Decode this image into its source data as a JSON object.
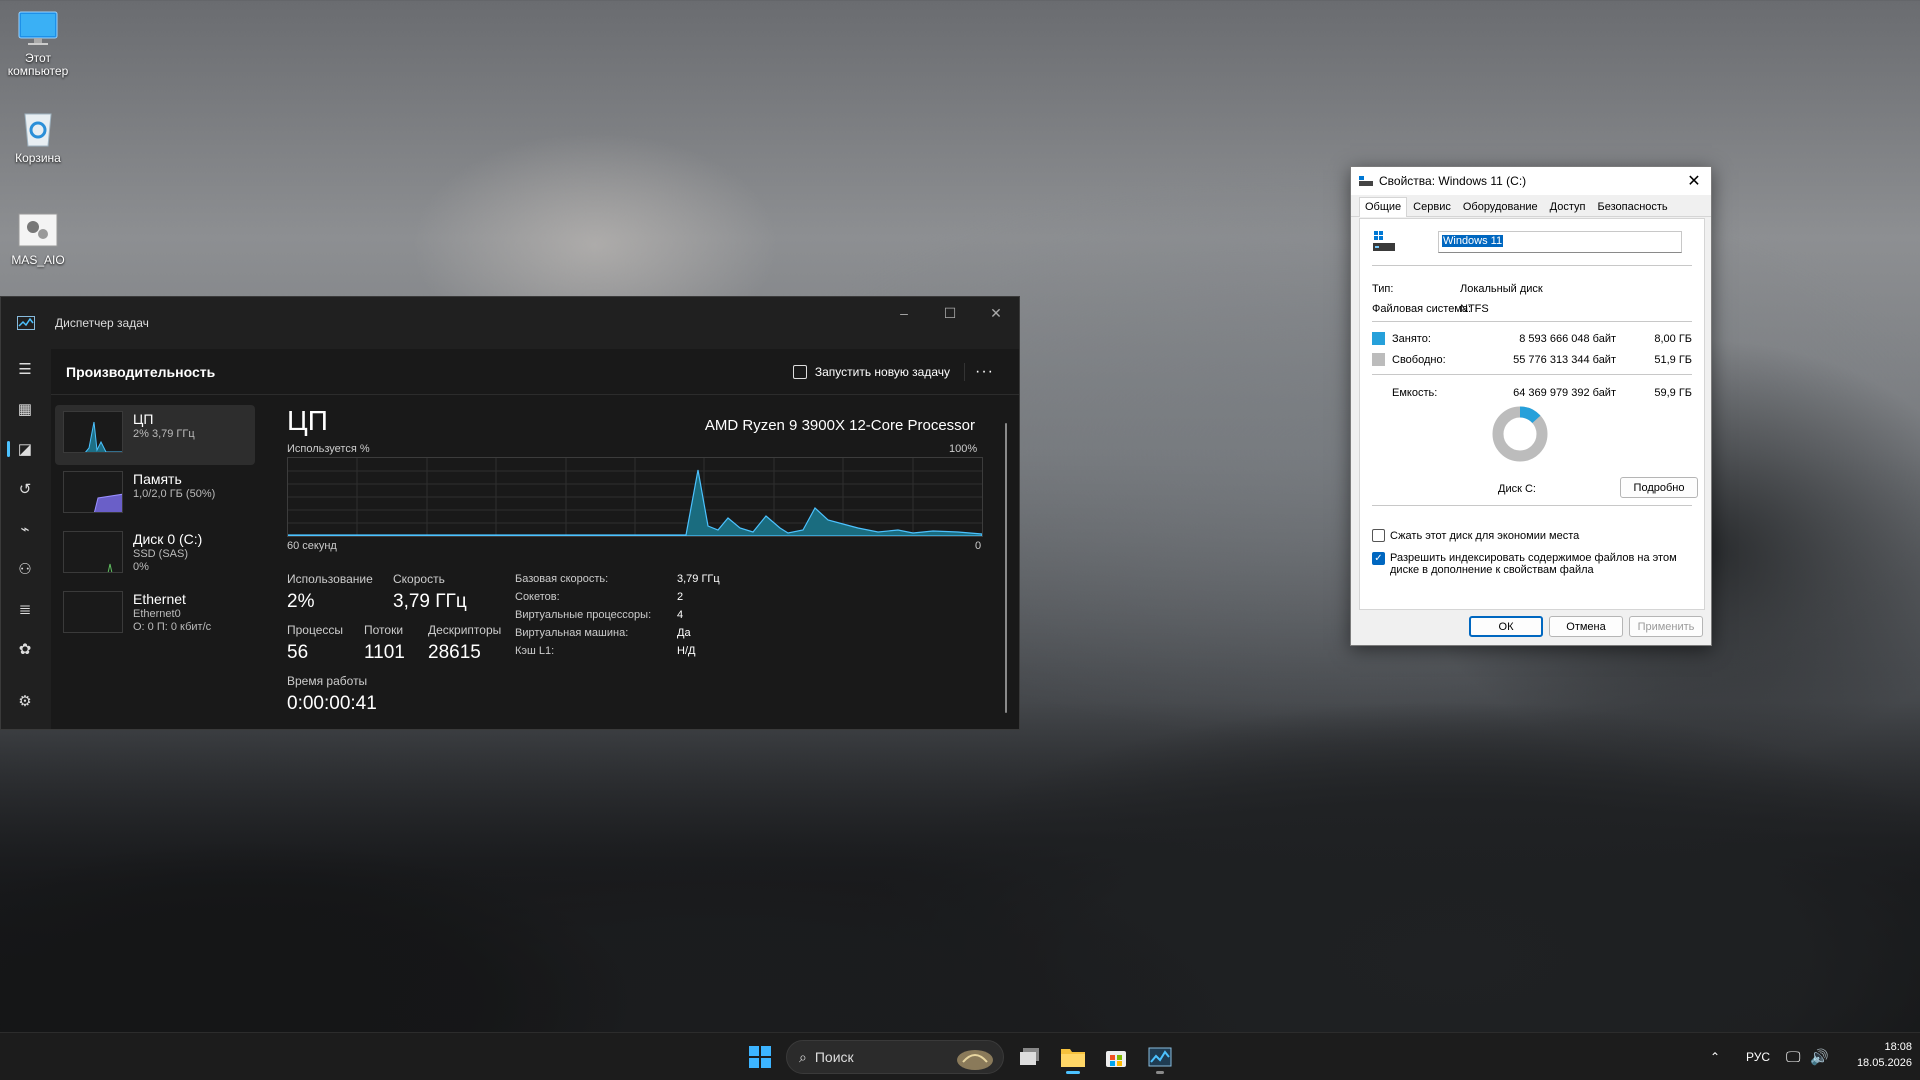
{
  "desktop": {
    "icons": [
      {
        "label": "Этот компьютер",
        "icon": "monitor-icon"
      },
      {
        "label": "Корзина",
        "icon": "recycle-bin-icon"
      },
      {
        "label": "MAS_AIO",
        "icon": "script-gear-icon"
      }
    ]
  },
  "taskmgr": {
    "title": "Диспетчер задач",
    "section": "Производительность",
    "run_task": "Запустить новую задачу",
    "more": "···",
    "list": [
      {
        "name": "ЦП",
        "sub1": "2% 3,79 ГГц",
        "sub2": ""
      },
      {
        "name": "Память",
        "sub1": "1,0/2,0 ГБ (50%)",
        "sub2": ""
      },
      {
        "name": "Диск 0 (C:)",
        "sub1": "SSD (SAS)",
        "sub2": "0%"
      },
      {
        "name": "Ethernet",
        "sub1": "Ethernet0",
        "sub2": "О: 0 П: 0 кбит/с"
      }
    ],
    "cpu": {
      "title": "ЦП",
      "processor": "AMD Ryzen 9 3900X 12-Core Processor",
      "usage_label": "Используется %",
      "max_label": "100%",
      "time_label": "60 секунд",
      "zero_label": "0",
      "stats": {
        "utilization_label": "Использование",
        "utilization": "2%",
        "speed_label": "Скорость",
        "speed": "3,79 ГГц",
        "processes_label": "Процессы",
        "processes": "56",
        "threads_label": "Потоки",
        "threads": "1101",
        "handles_label": "Дескрипторы",
        "handles": "28615",
        "uptime_label": "Время работы",
        "uptime": "0:00:00:41"
      },
      "info": [
        {
          "k": "Базовая скорость:",
          "v": "3,79 ГГц"
        },
        {
          "k": "Сокетов:",
          "v": "2"
        },
        {
          "k": "Виртуальные процессоры:",
          "v": "4"
        },
        {
          "k": "Виртуальная машина:",
          "v": "Да"
        },
        {
          "k": "Кэш L1:",
          "v": "Н/Д"
        }
      ]
    }
  },
  "props": {
    "title": "Свойства: Windows 11 (C:)",
    "tabs": [
      "Общие",
      "Сервис",
      "Оборудование",
      "Доступ",
      "Безопасность"
    ],
    "name_value": "Windows 11",
    "type_label": "Тип:",
    "type_value": "Локальный диск",
    "fs_label": "Файловая система:",
    "fs_value": "NTFS",
    "used_label": "Занято:",
    "used_bytes": "8 593 666 048 байт",
    "used_gb": "8,00 ГБ",
    "free_label": "Свободно:",
    "free_bytes": "55 776 313 344 байт",
    "free_gb": "51,9 ГБ",
    "cap_label": "Емкость:",
    "cap_bytes": "64 369 979 392 байт",
    "cap_gb": "59,9 ГБ",
    "used_fraction": 0.1335,
    "disk_label": "Диск C:",
    "details_btn": "Подробно",
    "compress_label": "Сжать этот диск для экономии места",
    "index_label": "Разрешить индексировать содержимое файлов на этом диске в дополнение к свойствам файла",
    "ok": "ОК",
    "cancel": "Отмена",
    "apply": "Применить",
    "colors": {
      "used": "#26a0da",
      "free": "#bcbcbc"
    }
  },
  "taskbar": {
    "search_placeholder": "Поиск",
    "lang": "РУС",
    "time": "18:08",
    "date": "18.05.2026"
  }
}
